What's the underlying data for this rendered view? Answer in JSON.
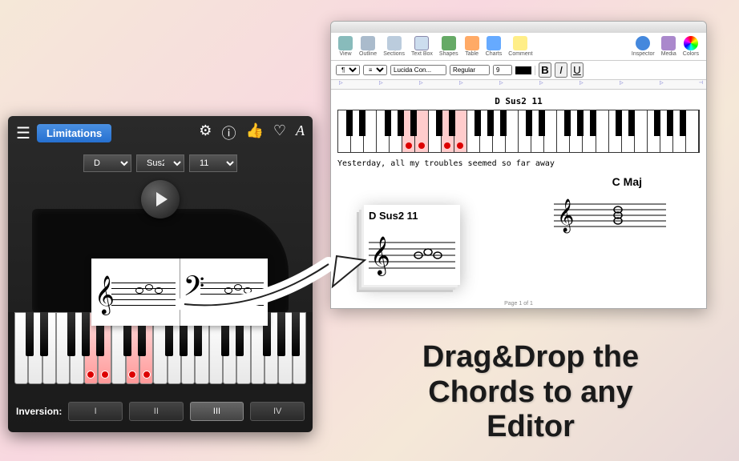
{
  "chord_app": {
    "limitations_label": "Limitations",
    "root": "D",
    "quality": "Sus2",
    "extension": "11",
    "inversion_label": "Inversion:",
    "inversions": [
      "I",
      "II",
      "III",
      "IV"
    ],
    "active_inversion": "III"
  },
  "editor": {
    "toolbar": {
      "view": "View",
      "outline": "Outline",
      "sections": "Sections",
      "textbox": "Text Box",
      "shapes": "Shapes",
      "table": "Table",
      "charts": "Charts",
      "comment": "Comment",
      "inspector": "Inspector",
      "media": "Media",
      "colors": "Colors"
    },
    "font_family": "Lucida Con...",
    "font_style": "Regular",
    "font_size": "9",
    "format_buttons": [
      "B",
      "I",
      "U"
    ],
    "chord_name": "D Sus2 11",
    "lyric": "Yesterday, all my troubles seemed so far away",
    "second_chord": "C Maj",
    "pager": "Page 1 of 1"
  },
  "drag": {
    "chord_name": "D Sus2 11"
  },
  "marketing": {
    "line1": "Drag&Drop the",
    "line2": "Chords to any",
    "line3": "Editor"
  }
}
